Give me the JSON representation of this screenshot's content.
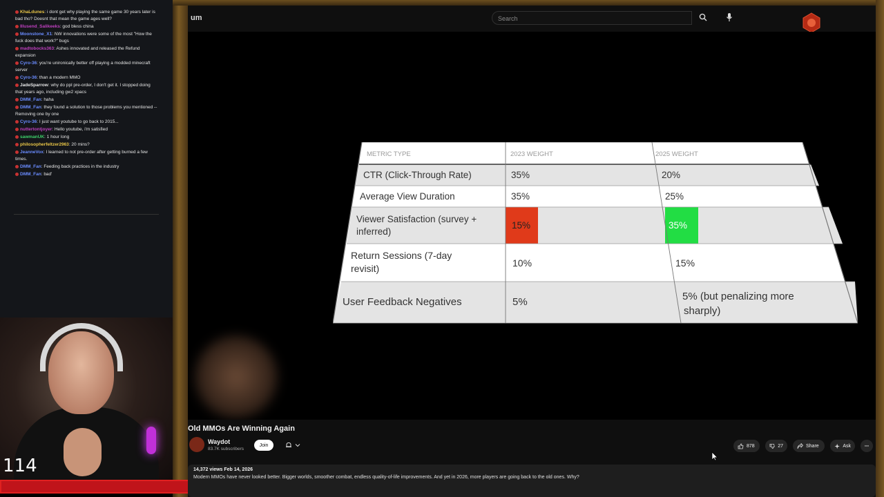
{
  "chat": {
    "messages": [
      {
        "user": "KhaLdunes",
        "text": "i dont get why playing the same game 30 years later is bad tho? Doesnt that mean the game ages well?",
        "color": "#e8c547"
      },
      {
        "user": "Illusend_Salikeeks",
        "text": "god bless china",
        "color": "#c040c0"
      },
      {
        "user": "Moonstone_X1",
        "text": "NW innovations were some of the most \"How the fuck does that work?\" bugs",
        "color": "#6a8cff"
      },
      {
        "user": "madtobocks363",
        "text": "Ashes innovated and released the Refund expansion",
        "color": "#c040c0"
      },
      {
        "user": "Cyro-36",
        "text": "you're unironically better off playing a modded minecraft server",
        "color": "#6a8cff"
      },
      {
        "user": "Cyro-36",
        "text": "than a modern MMO",
        "color": "#6a8cff"
      },
      {
        "user": "JadeSparrow",
        "text": "why do ppl pre-order, I don't get it. I stopped doing that years ago, including gw2 xpacs",
        "color": "#e8e8e8"
      },
      {
        "user": "DMM_Fan",
        "text": "haha",
        "color": "#6a8cff"
      },
      {
        "user": "DMM_Fan",
        "text": "they found a solution to those problems you mentioned -- Removing one by one",
        "color": "#6a8cff"
      },
      {
        "user": "Cyro-36",
        "text": "I just want youtube to go back to 2015...",
        "color": "#6a8cff"
      },
      {
        "user": "nuttertontjoyer",
        "text": "Hello youtube, i'm satisfied",
        "color": "#c040c0"
      },
      {
        "user": "sawmanUK",
        "text": "1 hour long",
        "color": "#3ecf6a"
      },
      {
        "user": "philosopherfeltzer2963",
        "text": "20 mins?",
        "color": "#e8c547"
      },
      {
        "user": "JeanneVox",
        "text": "I learned to not pre-order after getting burned a few times.",
        "color": "#6a8cff"
      },
      {
        "user": "DMM_Fan",
        "text": "Feeding back practices in the industry",
        "color": "#6a8cff"
      },
      {
        "user": "DMM_Fan",
        "text": "bad'",
        "color": "#6a8cff"
      }
    ]
  },
  "stream": {
    "counter": "114"
  },
  "youtube": {
    "logo_fragment": "um",
    "search_placeholder": "Search",
    "video_title": "Old MMOs Are Winning Again",
    "channel_name": "Waydot",
    "subscribers": "83.7K subscribers",
    "join_label": "Join",
    "likes": "878",
    "dislikes": "27",
    "share_label": "Share",
    "ask_label": "Ask",
    "views_date": "14,372 views  Feb 14, 2026",
    "description": "Modern MMOs have never looked better. Bigger worlds, smoother combat, endless quality-of-life improvements. And yet in 2026, more players are going back to the old ones. Why?"
  },
  "slide_table": {
    "headers": [
      "METRIC TYPE",
      "2023 WEIGHT",
      "2025 WEIGHT"
    ],
    "rows": [
      {
        "metric": "CTR (Click-Through Rate)",
        "w2023": "35%",
        "w2025": "20%"
      },
      {
        "metric": "Average View Duration",
        "w2023": "35%",
        "w2025": "25%"
      },
      {
        "metric": "Viewer Satisfaction (survey +",
        "metric2": "inferred)",
        "w2023": "15%",
        "w2025": "35%"
      },
      {
        "metric": "Return Sessions (7-day",
        "metric2": "revisit)",
        "w2023": "10%",
        "w2025": "15%"
      },
      {
        "metric": "User Feedback Negatives",
        "w2023": "5%",
        "w2025": "5% (but penalizing more",
        "w2025b": "sharply)"
      }
    ],
    "highlight_red": "#e03a1a",
    "highlight_green": "#22dd44"
  }
}
